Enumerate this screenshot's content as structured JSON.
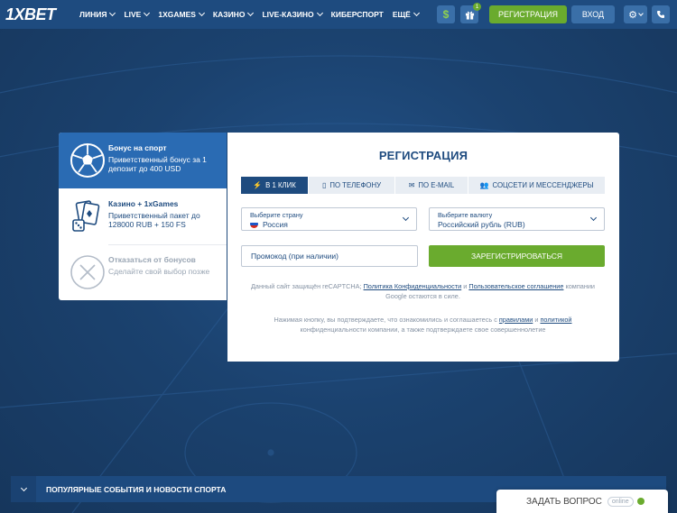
{
  "header": {
    "logo": "1XBET",
    "nav": [
      "ЛИНИЯ",
      "LIVE",
      "1XGAMES",
      "КАЗИНО",
      "LIVE-КАЗИНО",
      "КИБЕРСПОРТ",
      "ЕЩЁ"
    ],
    "nav_has_dropdown": [
      true,
      true,
      true,
      true,
      true,
      false,
      true
    ],
    "deposit_icon": "$",
    "gift_badge": "1",
    "register_label": "РЕГИСТРАЦИЯ",
    "login_label": "ВХОД"
  },
  "bonus": {
    "items": [
      {
        "title": "Бонус на спорт",
        "text": "Приветственный бонус за 1 депозит до 400 USD",
        "icon": "soccer-ball-icon"
      },
      {
        "title": "Казино + 1xGames",
        "text": "Приветственный пакет до 128000 RUB + 150 FS",
        "icon": "cards-dice-icon"
      },
      {
        "title": "Отказаться от бонусов",
        "text": "Сделайте свой выбор позже",
        "icon": "close-circle-icon"
      }
    ]
  },
  "registration": {
    "title": "РЕГИСТРАЦИЯ",
    "tabs": [
      "В 1 КЛИК",
      "ПО ТЕЛЕФОНУ",
      "ПО E-MAIL",
      "СОЦСЕТИ И МЕССЕНДЖЕРЫ"
    ],
    "country_label": "Выберите страну",
    "country_value": "Россия",
    "currency_label": "Выберите валюту",
    "currency_value": "Российский рубль (RUB)",
    "promo_placeholder": "Промокод (при наличии)",
    "submit_label": "ЗАРЕГИСТРИРОВАТЬСЯ",
    "recaptcha_prefix": "Данный сайт защищён reCAPTCHA;",
    "privacy_link": "Политика Конфиденциальности",
    "recaptcha_and": "и",
    "terms_link": "Пользовательское соглашение",
    "recaptcha_suffix": "компании Google остаются в силе.",
    "agree_prefix": "Нажимая кнопку, вы подтверждаете, что ознакомились и соглашаетесь с",
    "rules_link": "правилами",
    "agree_and": "и",
    "policy_link": "политикой",
    "agree_suffix": "конфиденциальности компании, а также подтверждаете свое совершеннолетие"
  },
  "popular": {
    "label": "ПОПУЛЯРНЫЕ СОБЫТИЯ И НОВОСТИ СПОРТА"
  },
  "chat": {
    "label": "ЗАДАТЬ ВОПРОС",
    "status": "online"
  },
  "colors": {
    "brand_blue": "#1e4b7f",
    "accent_green": "#6aab2e",
    "active_blue": "#2a6bb3"
  }
}
